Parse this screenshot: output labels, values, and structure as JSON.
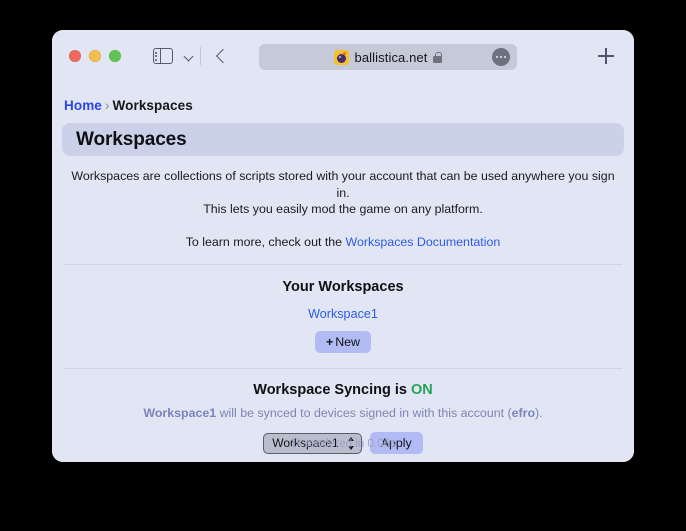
{
  "browser": {
    "traffic_lights": [
      "close",
      "minimize",
      "maximize"
    ],
    "sidebar_toggle_icon": "sidebar-icon",
    "tab_overview_icon": "chevron-down-icon",
    "back_icon": "back-arrow-icon",
    "url": "ballistica.net",
    "favicon": "bomb-favicon",
    "lock_icon": "lock-icon",
    "more_icon": "ellipsis-icon",
    "new_tab_icon": "plus-icon"
  },
  "breadcrumb": {
    "home": "Home",
    "separator": "›",
    "current": "Workspaces"
  },
  "page": {
    "title": "Workspaces",
    "intro_line1": "Workspaces are collections of scripts stored with your account that can be used anywhere you sign in.",
    "intro_line2": "This lets you easily mod the game on any platform.",
    "learn_prefix": "To learn more, check out the ",
    "learn_link": "Workspaces Documentation"
  },
  "your_workspaces": {
    "heading": "Your Workspaces",
    "items": [
      "Workspace1"
    ],
    "new_button_plus": "+",
    "new_button_label": "New"
  },
  "syncing": {
    "heading_prefix": "Workspace Syncing is ",
    "status": "ON",
    "status_color": "#23a455",
    "desc_workspace": "Workspace1",
    "desc_middle": " will be synced to devices signed in with this account (",
    "desc_account": "efro",
    "desc_suffix": ").",
    "selected_workspace": "Workspace1",
    "workspace_options": [
      "Workspace1"
    ],
    "apply_label": "Apply"
  },
  "footer": {
    "status": "1k rendered in 0.06s"
  }
}
